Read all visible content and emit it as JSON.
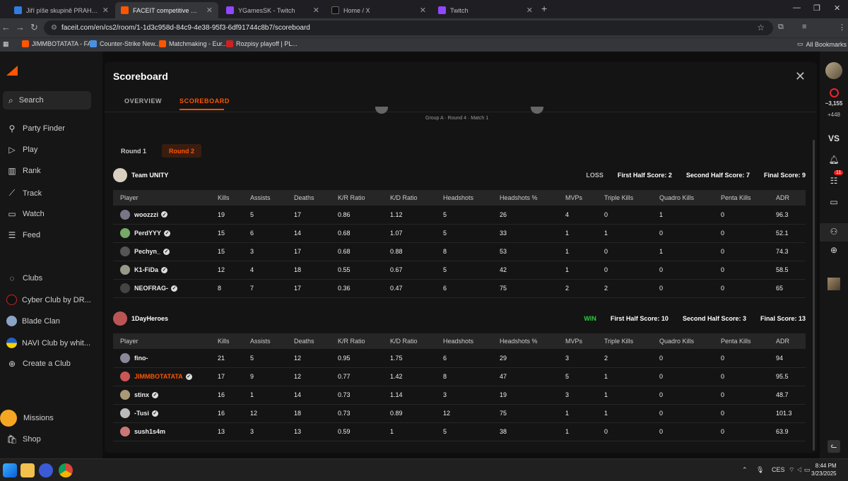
{
  "browser": {
    "tabs": [
      {
        "title": "Jiří píše skupině PRAHA LAN s...",
        "active": false
      },
      {
        "title": "FACEIT competitive match - FACEIT",
        "active": true
      },
      {
        "title": "YGamesSK - Twitch",
        "active": false
      },
      {
        "title": "Home / X",
        "active": false
      },
      {
        "title": "Twitch",
        "active": false
      }
    ],
    "new_tab": "+",
    "url": "faceit.com/en/cs2/room/1-1d3c958d-84c9-4e38-95f3-6df91744c8b7/scoreboard",
    "bookmarks": [
      "JIMMBOTATATA - FA...",
      "Counter-Strike New...",
      "Matchmaking - Eur...",
      "Rozpisy playoff | PL..."
    ],
    "all_bookmarks": "All Bookmarks"
  },
  "sidebar": {
    "search": "Search",
    "items": [
      "Party Finder",
      "Play",
      "Rank",
      "Track",
      "Watch",
      "Feed"
    ],
    "clubs_label": "Clubs",
    "clubs": [
      "Cyber Club by DR...",
      "Blade Clan",
      "NAVI Club by whit...",
      "Create a Club"
    ],
    "bottom": [
      "Missions",
      "Shop"
    ]
  },
  "rightrail": {
    "points": "~3,155",
    "delta": "+448",
    "vs": "VS",
    "notif_count": "11"
  },
  "modal": {
    "title": "Scoreboard",
    "tabs": [
      "OVERVIEW",
      "SCOREBOARD"
    ],
    "match_info": "Group A · Round 4 · Match 1",
    "rounds": [
      "Round 1",
      "Round 2"
    ],
    "columns": [
      "Player",
      "Kills",
      "Assists",
      "Deaths",
      "K/R Ratio",
      "K/D Ratio",
      "Headshots",
      "Headshots %",
      "MVPs",
      "Triple Kills",
      "Quadro Kills",
      "Penta Kills",
      "ADR"
    ],
    "teams": [
      {
        "name": "Team UNITY",
        "result": "LOSS",
        "first_half": "First Half Score: 2",
        "second_half": "Second Half Score: 7",
        "final": "Final Score: 9",
        "players": [
          [
            "woozzzi",
            "19",
            "5",
            "17",
            "0.86",
            "1.12",
            "5",
            "26",
            "4",
            "0",
            "1",
            "0",
            "96.3"
          ],
          [
            "PerdYYY",
            "15",
            "6",
            "14",
            "0.68",
            "1.07",
            "5",
            "33",
            "1",
            "1",
            "0",
            "0",
            "52.1"
          ],
          [
            "Pechyn_",
            "15",
            "3",
            "17",
            "0.68",
            "0.88",
            "8",
            "53",
            "1",
            "0",
            "1",
            "0",
            "74.3"
          ],
          [
            "K1-FiDa",
            "12",
            "4",
            "18",
            "0.55",
            "0.67",
            "5",
            "42",
            "1",
            "0",
            "0",
            "0",
            "58.5"
          ],
          [
            "NEOFRAG-",
            "8",
            "7",
            "17",
            "0.36",
            "0.47",
            "6",
            "75",
            "2",
            "2",
            "0",
            "0",
            "65"
          ]
        ]
      },
      {
        "name": "1DayHeroes",
        "result": "WIN",
        "first_half": "First Half Score: 10",
        "second_half": "Second Half Score: 3",
        "final": "Final Score: 13",
        "players": [
          [
            "fino-",
            "21",
            "5",
            "12",
            "0.95",
            "1.75",
            "6",
            "29",
            "3",
            "2",
            "0",
            "0",
            "94"
          ],
          [
            "JIMMBOTATATA",
            "17",
            "9",
            "12",
            "0.77",
            "1.42",
            "8",
            "47",
            "5",
            "1",
            "0",
            "0",
            "95.5"
          ],
          [
            "stinx",
            "16",
            "1",
            "14",
            "0.73",
            "1.14",
            "3",
            "19",
            "3",
            "1",
            "0",
            "0",
            "48.7"
          ],
          [
            "-Tusi",
            "16",
            "12",
            "18",
            "0.73",
            "0.89",
            "12",
            "75",
            "1",
            "1",
            "0",
            "0",
            "101.3"
          ],
          [
            "sush1s4m",
            "13",
            "3",
            "13",
            "0.59",
            "1",
            "5",
            "38",
            "1",
            "0",
            "0",
            "0",
            "63.9"
          ]
        ]
      }
    ]
  },
  "taskbar": {
    "lang": "CES",
    "time": "8:44 PM",
    "date": "3/23/2025"
  }
}
